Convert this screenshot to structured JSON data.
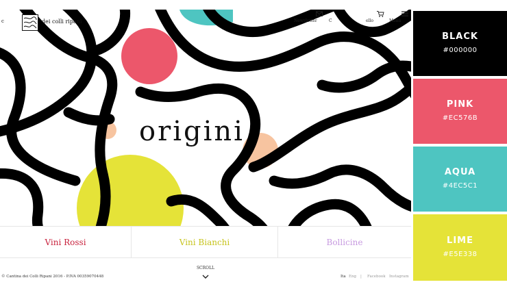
{
  "header": {
    "brand_prefix": "c",
    "brand_name": "dei colli ripani",
    "nav": {
      "newsletter": "Newsletter",
      "contatti": "C",
      "carrello": "ello",
      "menu": "Menù"
    }
  },
  "hero": {
    "title": "origini"
  },
  "tabs": [
    {
      "label": "Vini Rossi",
      "color": "#C8233E"
    },
    {
      "label": "Vini Bianchi",
      "color": "#C7C41E"
    },
    {
      "label": "Bollicine",
      "color": "#C79AE0"
    }
  ],
  "footer": {
    "copyright": "© Cantina dei Colli Ripani 2016 - P.IVA 00359070448",
    "scroll": "SCROLL",
    "languages": [
      "Ita",
      "Eng"
    ],
    "social": [
      "Facebook",
      "Instagram"
    ]
  },
  "palette": [
    {
      "name": "BLACK",
      "hex": "#000000",
      "color": "#000000",
      "text": "#ffffff"
    },
    {
      "name": "PINK",
      "hex": "#EC576B",
      "color": "#EC576B",
      "text": "#ffffff"
    },
    {
      "name": "AQUA",
      "hex": "#4EC5C1",
      "color": "#4EC5C1",
      "text": "#ffffff"
    },
    {
      "name": "LIME",
      "hex": "#E5E338",
      "color": "#E5E338",
      "text": "#ffffff"
    }
  ]
}
